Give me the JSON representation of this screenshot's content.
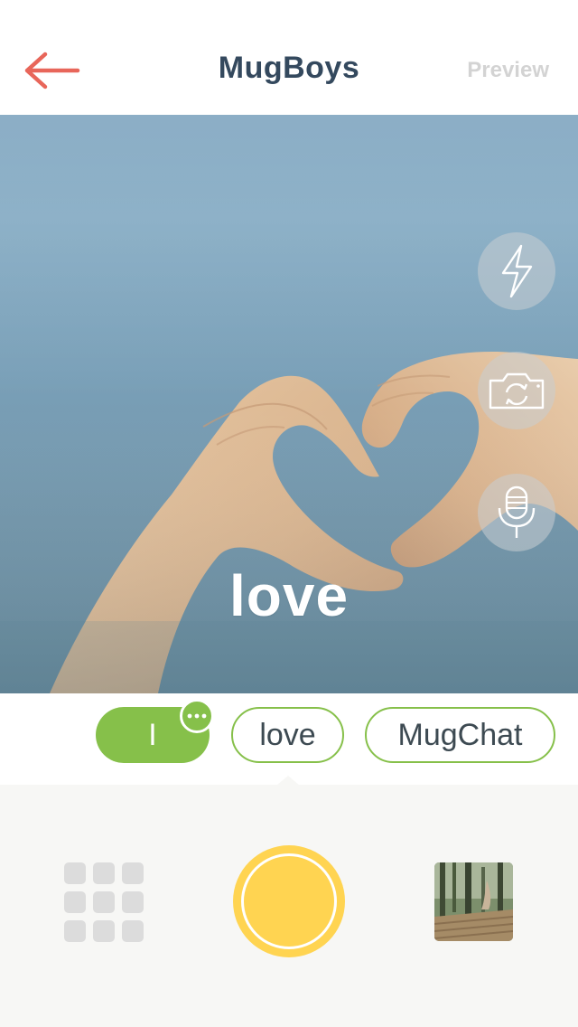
{
  "header": {
    "back_icon": "arrow-left-icon",
    "title": "MugBoys",
    "preview_label": "Preview"
  },
  "camera": {
    "caption": "love",
    "controls": [
      {
        "name": "flash-button",
        "icon": "lightning-bolt-icon"
      },
      {
        "name": "switch-camera-button",
        "icon": "camera-rotate-icon"
      },
      {
        "name": "microphone-button",
        "icon": "microphone-icon"
      }
    ]
  },
  "words": {
    "chips": [
      {
        "label": "I",
        "state": "active"
      },
      {
        "label": "love",
        "state": "inactive"
      },
      {
        "label": "MugChat",
        "state": "inactive"
      }
    ],
    "more_icon": "ellipsis-icon"
  },
  "bottom": {
    "grid_icon": "grid-icon",
    "shutter_icon": "shutter-icon",
    "gallery_icon": "gallery-thumbnail"
  },
  "colors": {
    "accent_red": "#e8665a",
    "title_text": "#34495e",
    "chip_green": "#86c04a",
    "shutter_yellow": "#ffd451",
    "bottom_bg": "#f7f7f5"
  }
}
